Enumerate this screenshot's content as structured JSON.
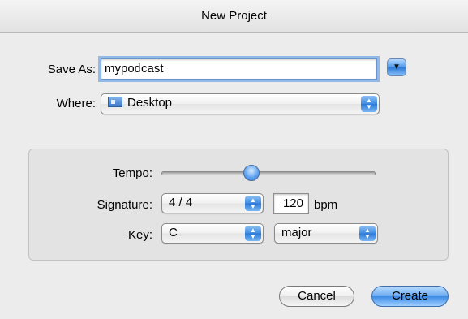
{
  "window": {
    "title": "New Project"
  },
  "save_as": {
    "label": "Save As:",
    "value": "mypodcast"
  },
  "where": {
    "label": "Where:",
    "value": "Desktop"
  },
  "tempo": {
    "label": "Tempo:",
    "level": 0.42
  },
  "signature": {
    "label": "Signature:",
    "value": "4 / 4"
  },
  "bpm": {
    "value": "120",
    "unit": "bpm"
  },
  "key": {
    "label": "Key:",
    "value": "C",
    "mode": "major"
  },
  "buttons": {
    "cancel": "Cancel",
    "create": "Create"
  },
  "icons": {
    "disclosure": "chevron-down-icon",
    "popup_arrows": "up-down-arrows-icon",
    "folder": "desktop-folder-icon"
  },
  "colors": {
    "accent": "#3b8ae6",
    "background": "#ececec"
  }
}
